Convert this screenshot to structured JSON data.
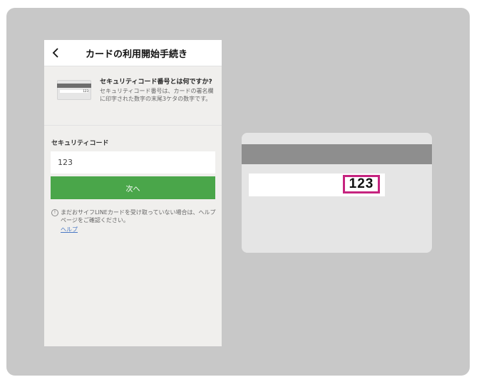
{
  "header": {
    "title": "カードの利用開始手続き",
    "back_icon": "chevron-left-icon"
  },
  "info": {
    "title": "セキュリティコード番号とは何ですか?",
    "description": "セキュリティコード番号は、カードの署名欄に印字された数字の末尾3ケタの数字です。",
    "thumb_number": "123"
  },
  "form": {
    "label": "セキュリティコード",
    "input_value": "123",
    "next_label": "次へ"
  },
  "note": {
    "icon": "info-icon",
    "text": "まだおサイフLINEカードを受け取っていない場合は、ヘルプページをご確認ください。",
    "help_link": "ヘルプ"
  },
  "card_back": {
    "security_code": "123"
  },
  "colors": {
    "accent": "#4aa64a",
    "highlight": "#c6247f",
    "background": "#c8c8c8"
  }
}
